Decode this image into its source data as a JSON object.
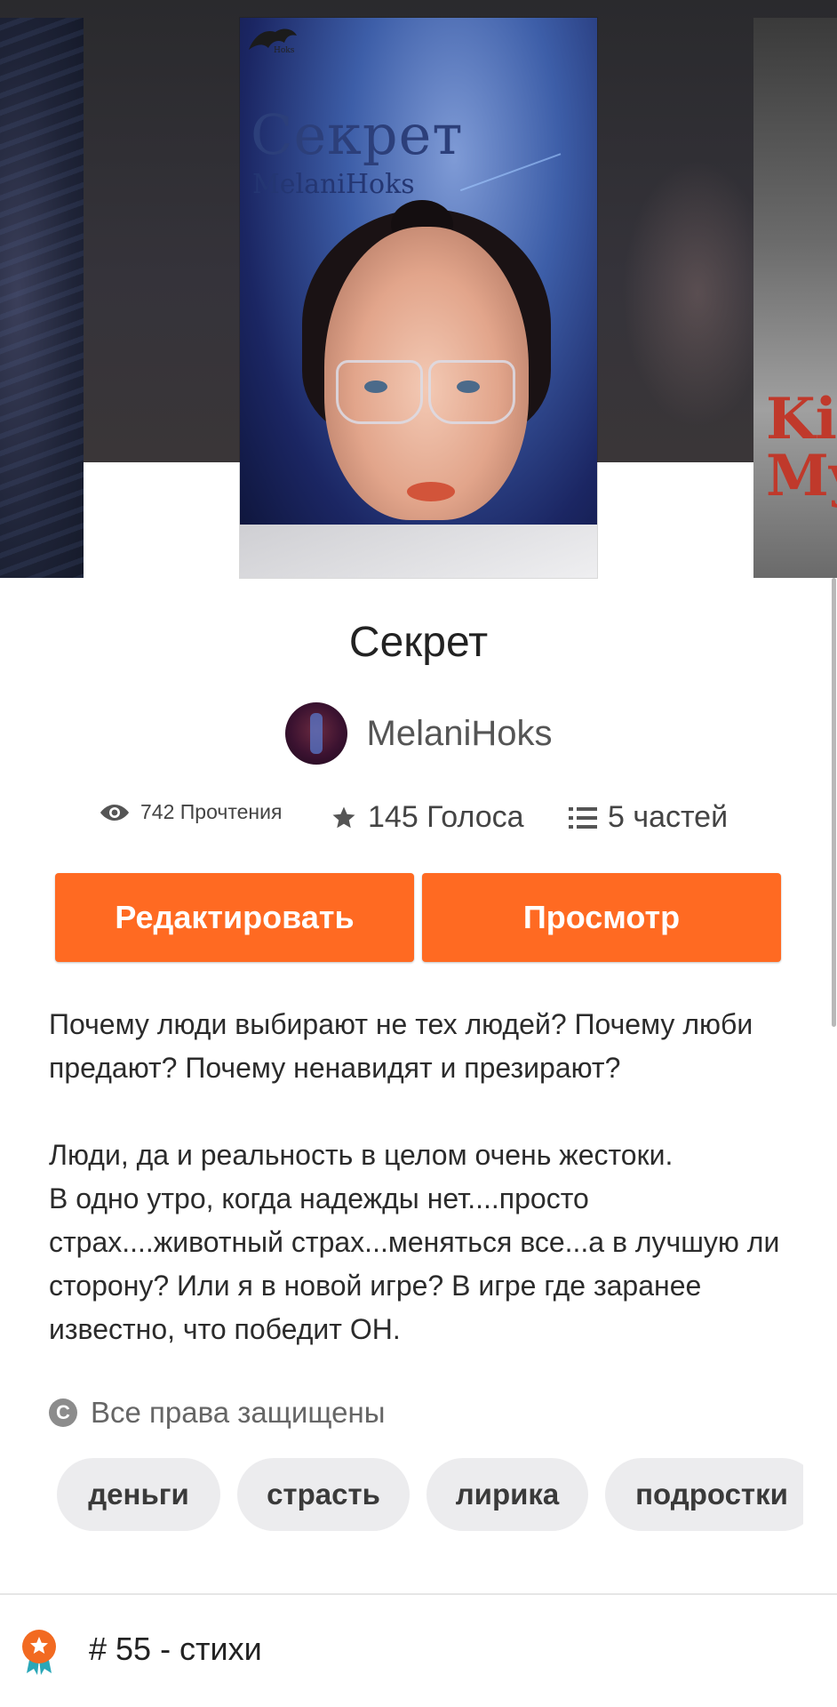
{
  "covers": {
    "main_title": "Секрет",
    "main_author": "MelaniHoks",
    "right_partial_text": "Ki\nMy"
  },
  "story": {
    "title": "Секрет",
    "author": "MelaniHoks"
  },
  "stats": {
    "reads": "742 Прочтения",
    "votes": "145 Голоса",
    "parts": "5 частей"
  },
  "actions": {
    "edit_label": "Редактировать",
    "preview_label": "Просмотр"
  },
  "description": "Почему люди выбирают не тех людей? Почему люби предают? Почему ненавидят и презирают?\n\nЛюди, да и реальность в целом очень жестоки.\nВ одно утро, когда надежды нет....просто страх....животный страх...меняться все...а в лучшую ли сторону? Или я в новой игре? В игре где заранее известно, что победит ОН.",
  "copyright": "Все права защищены",
  "tags": [
    "деньги",
    "страсть",
    "лирика",
    "подростки"
  ],
  "ranking": "# 55 - стихи",
  "colors": {
    "accent": "#ff6a22",
    "tag_bg": "#ececee",
    "rank_badge": "#f26a21",
    "rank_ribbon": "#2aa7b8"
  }
}
